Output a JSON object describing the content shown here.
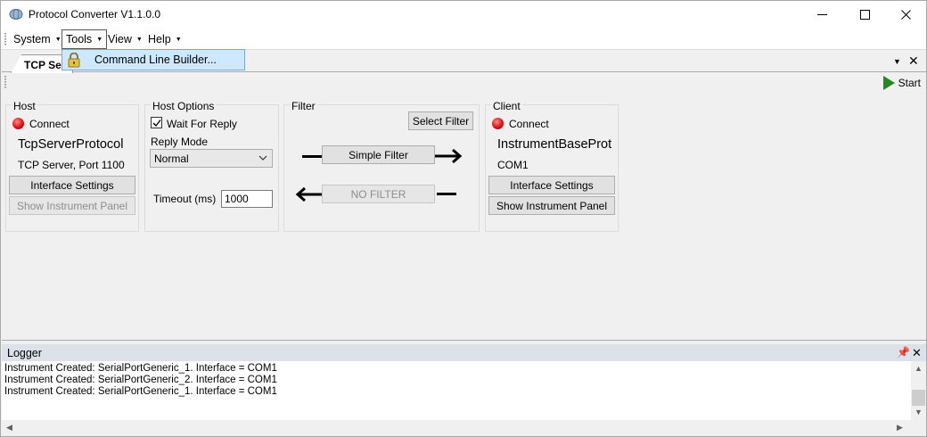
{
  "window": {
    "title": "Protocol Converter V1.1.0.0"
  },
  "menu": {
    "items": [
      {
        "label": "System"
      },
      {
        "label": "Tools"
      },
      {
        "label": "View"
      },
      {
        "label": "Help"
      }
    ],
    "open_dropdown": {
      "item": "Command Line Builder..."
    }
  },
  "tab": {
    "label": "TCP Ser"
  },
  "toolbar": {
    "start_label": "Start"
  },
  "host": {
    "title": "Host",
    "connect_label": "Connect",
    "protocol": "TcpServerProtocol",
    "detail": "TCP Server, Port 1100",
    "interface_button": "Interface Settings",
    "instrument_button": "Show Instrument Panel"
  },
  "host_options": {
    "title": "Host Options",
    "wait_for_reply_label": "Wait For Reply",
    "wait_for_reply_checked": true,
    "reply_mode_label": "Reply Mode",
    "reply_mode_value": "Normal",
    "timeout_label": "Timeout (ms)",
    "timeout_value": "1000"
  },
  "filter": {
    "title": "Filter",
    "select_button": "Select Filter",
    "forward_button": "Simple Filter",
    "reverse_button": "NO FILTER"
  },
  "client": {
    "title": "Client",
    "connect_label": "Connect",
    "protocol": "InstrumentBaseProt",
    "detail": "COM1",
    "interface_button": "Interface Settings",
    "instrument_button": "Show Instrument Panel"
  },
  "logger": {
    "title": "Logger",
    "lines": [
      "Instrument Created: SerialPortGeneric_1. Interface = COM1",
      "Instrument Created: SerialPortGeneric_2. Interface = COM1",
      "Instrument Created: SerialPortGeneric_1. Interface = COM1"
    ]
  },
  "colors": {
    "led": "#dd1111",
    "start_icon": "#1f8a1f",
    "dropdown_highlight": "#cde8ff",
    "logger_header": "#dde2ea"
  }
}
